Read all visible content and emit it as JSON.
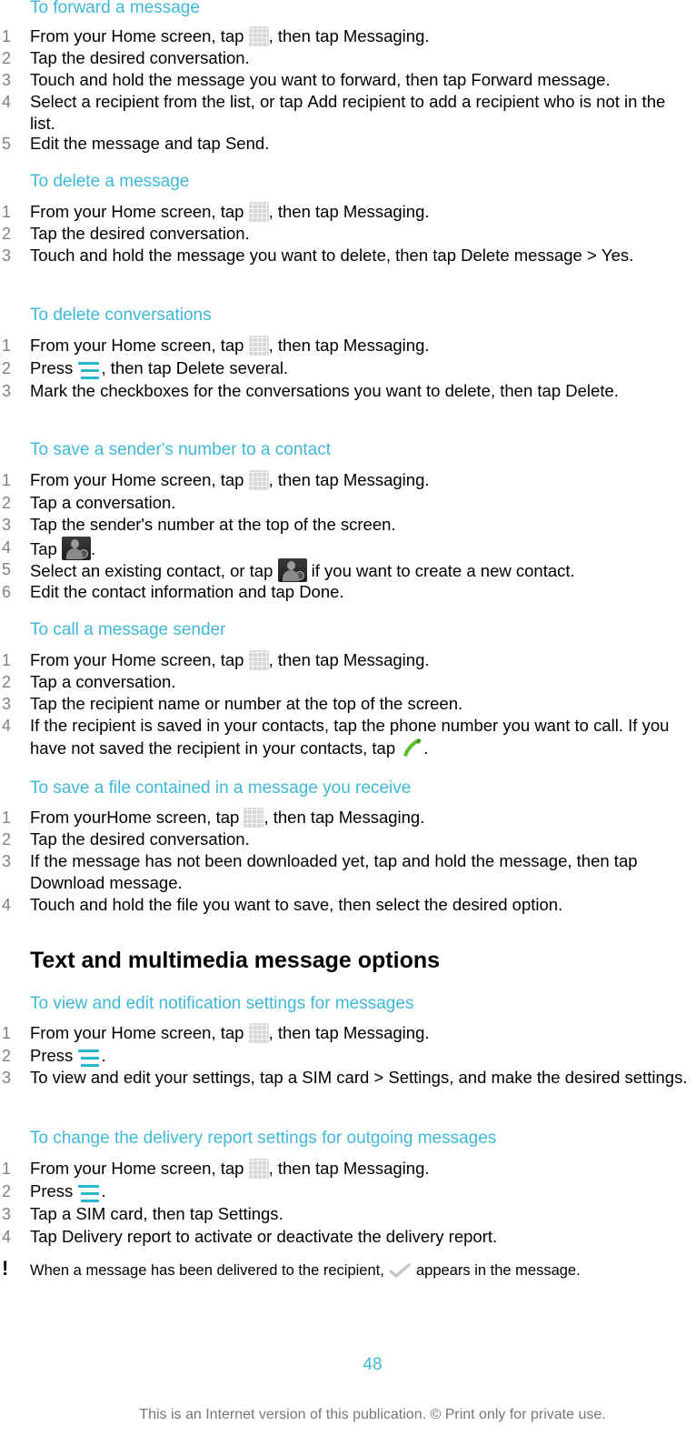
{
  "sections": [
    {
      "heading": "To forward a message",
      "steps": [
        {
          "n": "1",
          "parts": [
            {
              "t": "From your Home screen, tap "
            },
            {
              "icon": "app-grid"
            },
            {
              "t": ", then tap "
            },
            {
              "b": "Messaging"
            },
            {
              "t": "."
            }
          ]
        },
        {
          "n": "2",
          "parts": [
            {
              "t": "Tap the desired conversation."
            }
          ]
        },
        {
          "n": "3",
          "parts": [
            {
              "t": "Touch and hold the message you want to forward, then tap "
            },
            {
              "b": "Forward message"
            },
            {
              "t": "."
            }
          ]
        },
        {
          "n": "4",
          "parts": [
            {
              "t": "Select a recipient from the list, or tap "
            },
            {
              "b": "Add recipient"
            },
            {
              "t": " to add a recipient who is not in the list."
            }
          ]
        },
        {
          "n": "5",
          "parts": [
            {
              "t": "Edit the message and tap "
            },
            {
              "b": "Send"
            },
            {
              "t": "."
            }
          ]
        }
      ]
    },
    {
      "heading": "To delete a message",
      "steps": [
        {
          "n": "1",
          "parts": [
            {
              "t": "From your Home screen, tap "
            },
            {
              "icon": "app-grid"
            },
            {
              "t": ", then tap "
            },
            {
              "b": "Messaging"
            },
            {
              "t": "."
            }
          ]
        },
        {
          "n": "2",
          "parts": [
            {
              "t": "Tap the desired conversation."
            }
          ]
        },
        {
          "n": "3",
          "parts": [
            {
              "t": "Touch and hold the message you want to delete, then tap "
            },
            {
              "b": "Delete message"
            },
            {
              "t": " > "
            },
            {
              "b": "Yes"
            },
            {
              "t": "."
            }
          ]
        }
      ]
    },
    {
      "heading": "To delete conversations",
      "steps": [
        {
          "n": "1",
          "parts": [
            {
              "t": "From your Home screen, tap "
            },
            {
              "icon": "app-grid"
            },
            {
              "t": ", then tap "
            },
            {
              "b": "Messaging"
            },
            {
              "t": "."
            }
          ]
        },
        {
          "n": "2",
          "parts": [
            {
              "t": "Press "
            },
            {
              "icon": "menu"
            },
            {
              "t": ", then tap "
            },
            {
              "b": "Delete several"
            },
            {
              "t": "."
            }
          ]
        },
        {
          "n": "3",
          "parts": [
            {
              "t": "Mark the checkboxes for the conversations you want to delete, then tap "
            },
            {
              "b": "Delete"
            },
            {
              "t": "."
            }
          ]
        }
      ]
    },
    {
      "heading": "To save a sender's number to a contact",
      "steps": [
        {
          "n": "1",
          "parts": [
            {
              "t": "From your Home screen, tap "
            },
            {
              "icon": "app-grid"
            },
            {
              "t": ", then tap "
            },
            {
              "b": "Messaging"
            },
            {
              "t": "."
            }
          ]
        },
        {
          "n": "2",
          "parts": [
            {
              "t": "Tap a conversation."
            }
          ]
        },
        {
          "n": "3",
          "parts": [
            {
              "t": "Tap the sender's number at the top of the screen."
            }
          ]
        },
        {
          "n": "4",
          "parts": [
            {
              "t": "Tap "
            },
            {
              "icon": "add-contact"
            },
            {
              "t": "."
            }
          ]
        },
        {
          "n": "5",
          "parts": [
            {
              "t": "Select an existing contact, or tap "
            },
            {
              "icon": "add-contact"
            },
            {
              "t": " if you want to create a new contact."
            }
          ]
        },
        {
          "n": "6",
          "parts": [
            {
              "t": "Edit the contact information and tap "
            },
            {
              "b": "Done"
            },
            {
              "t": "."
            }
          ]
        }
      ]
    },
    {
      "heading": "To call a message sender",
      "steps": [
        {
          "n": "1",
          "parts": [
            {
              "t": "From your Home screen, tap "
            },
            {
              "icon": "app-grid"
            },
            {
              "t": ", then tap "
            },
            {
              "b": "Messaging"
            },
            {
              "t": "."
            }
          ]
        },
        {
          "n": "2",
          "parts": [
            {
              "t": "Tap a conversation."
            }
          ]
        },
        {
          "n": "3",
          "parts": [
            {
              "t": "Tap the recipient name or number at the top of the screen."
            }
          ]
        },
        {
          "n": "4",
          "parts": [
            {
              "t": "If the recipient is saved in your contacts, tap the phone number you want to call. If you have not saved the recipient in your contacts, tap "
            },
            {
              "icon": "phone"
            },
            {
              "t": "."
            }
          ]
        }
      ]
    },
    {
      "heading": "To save a file contained in a message you receive",
      "steps": [
        {
          "n": "1",
          "parts": [
            {
              "t": "From yourHome screen, tap "
            },
            {
              "icon": "app-grid"
            },
            {
              "t": ", then tap "
            },
            {
              "b": "Messaging"
            },
            {
              "t": "."
            }
          ]
        },
        {
          "n": "2",
          "parts": [
            {
              "t": "Tap the desired conversation."
            }
          ]
        },
        {
          "n": "3",
          "parts": [
            {
              "t": "If the message has not been downloaded yet, tap and hold the message, then tap "
            },
            {
              "b": "Download message"
            },
            {
              "t": "."
            }
          ]
        },
        {
          "n": "4",
          "parts": [
            {
              "t": "Touch and hold the file you want to save, then select the desired option."
            }
          ]
        }
      ]
    },
    {
      "chapter": "Text and multimedia message options"
    },
    {
      "heading": "To view and edit notification settings for messages",
      "steps": [
        {
          "n": "1",
          "parts": [
            {
              "t": "From your Home screen, tap "
            },
            {
              "icon": "app-grid"
            },
            {
              "t": ", then tap "
            },
            {
              "b": "Messaging"
            },
            {
              "t": "."
            }
          ]
        },
        {
          "n": "2",
          "parts": [
            {
              "t": "Press "
            },
            {
              "icon": "menu"
            },
            {
              "t": "."
            }
          ]
        },
        {
          "n": "3",
          "parts": [
            {
              "t": "To view and edit your settings, tap a SIM card > "
            },
            {
              "b": "Settings"
            },
            {
              "t": ", and make the desired settings."
            }
          ]
        }
      ]
    },
    {
      "heading": "To change the delivery report settings for outgoing messages",
      "steps": [
        {
          "n": "1",
          "parts": [
            {
              "t": "From your Home screen, tap "
            },
            {
              "icon": "app-grid"
            },
            {
              "t": ", then tap "
            },
            {
              "b": "Messaging"
            },
            {
              "t": "."
            }
          ]
        },
        {
          "n": "2",
          "parts": [
            {
              "t": "Press "
            },
            {
              "icon": "menu"
            },
            {
              "t": "."
            }
          ]
        },
        {
          "n": "3",
          "parts": [
            {
              "t": "Tap a SIM card, then tap "
            },
            {
              "b": "Settings"
            },
            {
              "t": "."
            }
          ]
        },
        {
          "n": "4",
          "parts": [
            {
              "t": "Tap "
            },
            {
              "b": "Delivery report"
            },
            {
              "t": " to activate or deactivate the delivery report."
            }
          ]
        }
      ]
    }
  ],
  "note": {
    "mark": "!",
    "parts": [
      {
        "t": "When a message has been delivered to the recipient, "
      },
      {
        "icon": "delivered-check"
      },
      {
        "t": " appears in the message."
      }
    ]
  },
  "page_number": "48",
  "footer": "This is an Internet version of this publication. © Print only for private use.",
  "colors": {
    "heading": "#3fb7d8",
    "menu_icon": "#2bb6cf",
    "step_number": "#808080"
  }
}
